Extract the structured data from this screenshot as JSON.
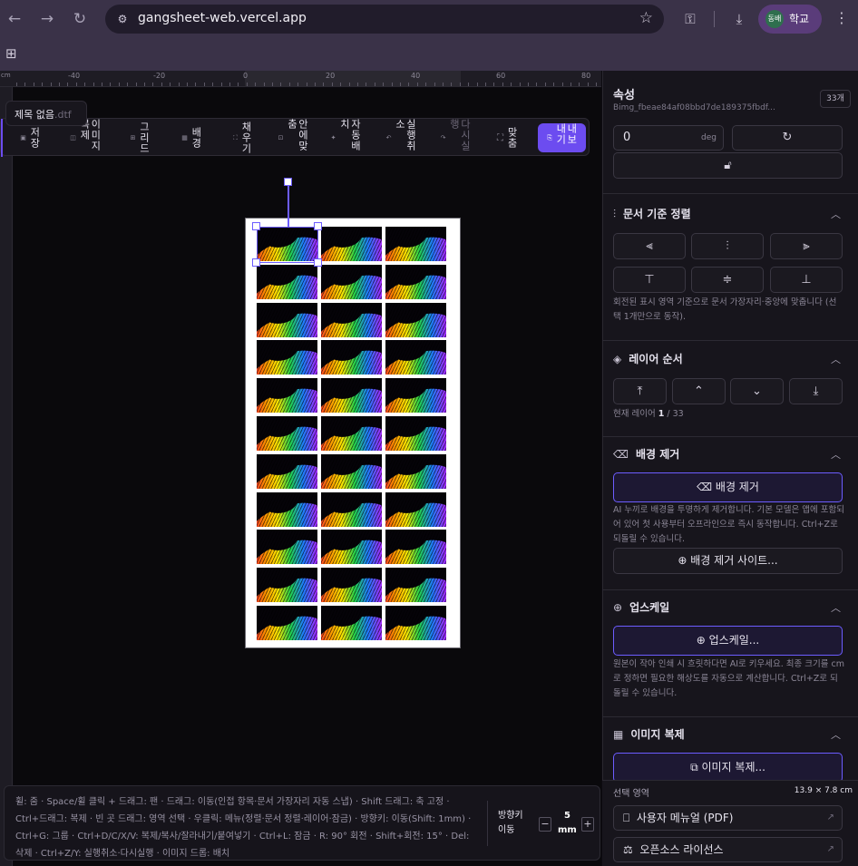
{
  "browser": {
    "url": "gangsheet-web.vercel.app",
    "profile_avatar": "동배",
    "profile_label": "학교"
  },
  "document": {
    "title": "제목 없음",
    "extension": ".dtf"
  },
  "ruler": {
    "unit": "cm",
    "ticks": [
      "-40",
      "-20",
      "0",
      "20",
      "40",
      "60",
      "80"
    ]
  },
  "toolbar": {
    "save": "저장",
    "duplicate": "이미지복제",
    "grid": "그리드",
    "background": "배경",
    "fill": "채우기",
    "fit_inside": "안에맞춤",
    "auto_arrange": "자동배치",
    "undo": "실행취소",
    "redo": "다시실행",
    "fit": "맞춤",
    "export": "내보내기"
  },
  "hint": {
    "text": "휠: 줌 · Space/휠 클릭 + 드래그: 팬 · 드래그: 이동(인접 항목·문서 가장자리 자동 스냅) · Shift 드래그: 축 고정 · Ctrl+드래그: 복제 · 빈 곳 드래그: 영역 선택 · 우클릭: 메뉴(정렬·문서 정렬·레이어·잠금) · 방향키: 이동(Shift: 1mm) · Ctrl+G: 그룹 · Ctrl+D/C/X/V: 복제/복사/잘라내기/붙여넣기 · Ctrl+L: 잠금 · R: 90° 회전 · Shift+회전: 15° · Del: 삭제 · Ctrl+Z/Y: 실행취소·다시실행 · 이미지 드롭: 배치",
    "arrow_label_1": "방향키",
    "arrow_label_2": "이동",
    "minus": "−",
    "plus": "+",
    "step_value": "5",
    "step_unit": "mm"
  },
  "panel": {
    "title": "속성",
    "image_id": "Bimg_fbeae84af08bbd7de189375fbdf...",
    "count": "33개",
    "rotation_value": "0",
    "rotation_unit": "deg",
    "sections": {
      "align": {
        "title": "문서 기준 정렬",
        "desc": "회전된 표시 영역 기준으로 문서 가장자리·중앙에 맞춥니다 (선택 1개만으로 동작)."
      },
      "layer": {
        "title": "레이어 순서",
        "current_label": "현재 레이어",
        "current": "1",
        "total": "33"
      },
      "bg_remove": {
        "title": "배경 제거",
        "button": "배경 제거",
        "desc": "AI 누끼로 배경을 투명하게 제거합니다. 기본 모델은 앱에 포함되어 있어 첫 사용부터 오프라인으로 즉시 동작합니다. Ctrl+Z로 되돌릴 수 있습니다.",
        "site_button": "배경 제거 사이트..."
      },
      "upscale": {
        "title": "업스케일",
        "button": "업스케일...",
        "desc": "원본이 작아 인쇄 시 흐릿하다면 AI로 키우세요. 최종 크기를 cm로 정하면 필요한 해상도를 자동으로 계산합니다. Ctrl+Z로 되돌릴 수 있습니다."
      },
      "duplicate": {
        "title": "이미지 복제",
        "button": "이미지 복제..."
      }
    },
    "footer": {
      "selection_label": "선택 영역",
      "selection_size": "13.9 × 7.8 cm",
      "manual": "사용자 메뉴얼 (PDF)",
      "license": "오픈소스 라이선스"
    }
  },
  "colors": {
    "accent": "#6c4cf0",
    "selection": "#6c5cff"
  },
  "sheet": {
    "columns": 3,
    "rows": 11
  }
}
